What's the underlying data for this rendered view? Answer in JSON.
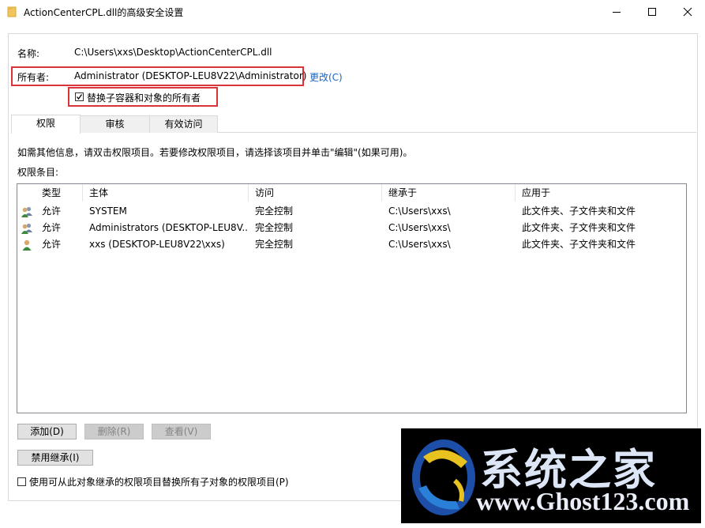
{
  "window": {
    "title": "ActionCenterCPL.dll的高级安全设置",
    "minimize_icon": "minimize-icon",
    "maximize_icon": "maximize-icon",
    "close_icon": "close-icon"
  },
  "name_row": {
    "label": "名称:",
    "value": "C:\\Users\\xxs\\Desktop\\ActionCenterCPL.dll"
  },
  "owner_row": {
    "label": "所有者:",
    "value": "Administrator (DESKTOP-LEU8V22\\Administrator)",
    "change_link": "更改(C)"
  },
  "replace_owner": {
    "label": "替换子容器和对象的所有者",
    "checked": true
  },
  "tabs": [
    {
      "label": "权限",
      "active": true
    },
    {
      "label": "审核",
      "active": false
    },
    {
      "label": "有效访问",
      "active": false
    }
  ],
  "info_text": "如需其他信息，请双击权限项目。若要修改权限项目，请选择该项目并单击\"编辑\"(如果可用)。",
  "entries_label": "权限条目:",
  "columns": [
    "类型",
    "主体",
    "访问",
    "继承于",
    "应用于"
  ],
  "rows": [
    {
      "icon": "user-group-icon",
      "type": "允许",
      "principal": "SYSTEM",
      "access": "完全控制",
      "inherited": "C:\\Users\\xxs\\",
      "applies": "此文件夹、子文件夹和文件"
    },
    {
      "icon": "user-group-icon",
      "type": "允许",
      "principal": "Administrators (DESKTOP-LEU8V...",
      "access": "完全控制",
      "inherited": "C:\\Users\\xxs\\",
      "applies": "此文件夹、子文件夹和文件"
    },
    {
      "icon": "user-icon",
      "type": "允许",
      "principal": "xxs (DESKTOP-LEU8V22\\xxs)",
      "access": "完全控制",
      "inherited": "C:\\Users\\xxs\\",
      "applies": "此文件夹、子文件夹和文件"
    }
  ],
  "buttons": {
    "add": "添加(D)",
    "remove": "删除(R)",
    "view": "查看(V)",
    "disable_inherit": "禁用继承(I)"
  },
  "replace_child": {
    "label": "使用可从此对象继承的权限项目替换所有子对象的权限项目(P)",
    "checked": false
  },
  "watermark": {
    "main": "系统之家",
    "url": "www.Ghost123.com"
  },
  "colors": {
    "highlight_red": "#d9343a",
    "link_blue": "#1a63c7"
  }
}
